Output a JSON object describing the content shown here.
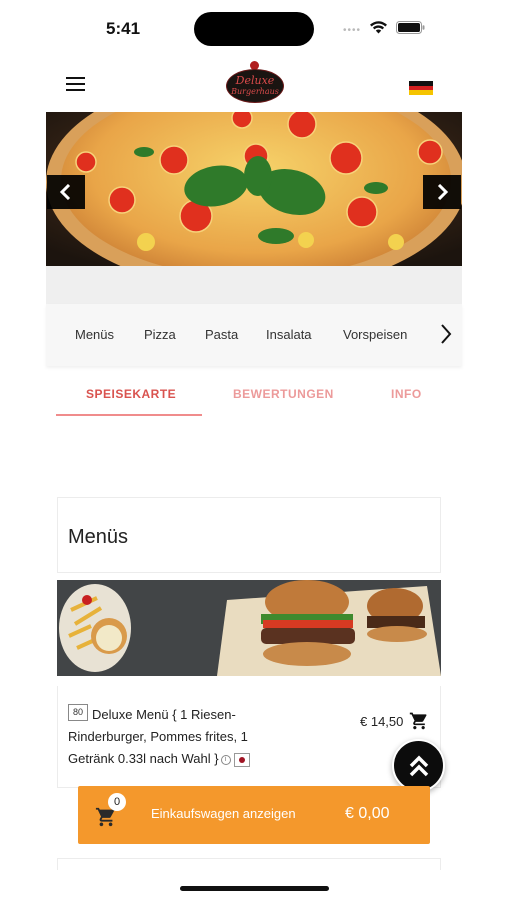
{
  "status_bar": {
    "time": "5:41"
  },
  "header": {
    "logo_line1": "Deluxe",
    "logo_line2": "Burgerhaus",
    "language": "de"
  },
  "categories": [
    "Menüs",
    "Pizza",
    "Pasta",
    "Insalata",
    "Vorspeisen"
  ],
  "tabs": [
    {
      "label": "SPEISEKARTE",
      "active": true
    },
    {
      "label": "BEWERTUNGEN",
      "active": false
    },
    {
      "label": "INFO",
      "active": false
    }
  ],
  "section": {
    "title": "Menüs"
  },
  "product": {
    "number": "80",
    "name": "Deluxe Menü { 1 Riesen-Rinderburger, Pommes frites, 1 Getränk 0.33l nach Wahl }",
    "price": "€ 14,50"
  },
  "cart": {
    "count": "0",
    "label": "Einkaufswagen anzeigen",
    "total": "€ 0,00"
  },
  "colors": {
    "accent": "#d9534f",
    "tab_inactive": "#ec9a9a",
    "cart_bar": "#f4982c"
  }
}
